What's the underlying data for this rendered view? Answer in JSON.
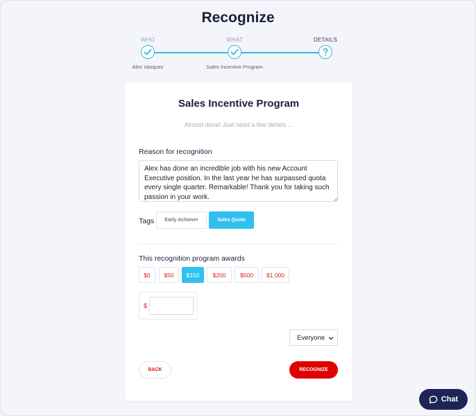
{
  "page": {
    "title": "Recognize"
  },
  "stepper": {
    "steps": [
      {
        "label": "WHO",
        "value": "Alex Vasquez",
        "state": "complete",
        "icon": "check-icon"
      },
      {
        "label": "WHAT",
        "value": "Sales Incentive Program",
        "state": "complete",
        "icon": "check-icon"
      },
      {
        "label": "DETAILS",
        "value": "",
        "state": "current",
        "icon": "question-icon"
      }
    ],
    "accent_color": "#36b6dc"
  },
  "card": {
    "title": "Sales Incentive Program",
    "subtitle": "Almost done! Just need a few details ..."
  },
  "reason": {
    "label": "Reason for recognition",
    "value": "Alex has done an incredible job with his new Account Executive position. In the last year he has surpassed quota every single quarter. Remarkable! Thank you for taking such passion in your work."
  },
  "tags": {
    "label": "Tags",
    "items": [
      {
        "label": "Early Achiever",
        "selected": false
      },
      {
        "label": "Sales Quota",
        "selected": true
      }
    ]
  },
  "awards": {
    "label": "This recognition program awards",
    "options": [
      {
        "label": "$0",
        "selected": false
      },
      {
        "label": "$50",
        "selected": false
      },
      {
        "label": "$150",
        "selected": true
      },
      {
        "label": "$200",
        "selected": false
      },
      {
        "label": "$500",
        "selected": false
      },
      {
        "label": "$1,000",
        "selected": false
      }
    ],
    "custom_prefix": "$",
    "custom_value": ""
  },
  "visibility": {
    "selected": "Everyone"
  },
  "actions": {
    "back_label": "BACK",
    "recognize_label": "RECOGNIZE"
  },
  "chat": {
    "label": "Chat",
    "icon": "chat-bubble-icon"
  },
  "colors": {
    "brand_red": "#e00000",
    "selected_blue": "#2fc0ee",
    "chat_navy": "#1f2457",
    "background": "#f4f5fa"
  }
}
